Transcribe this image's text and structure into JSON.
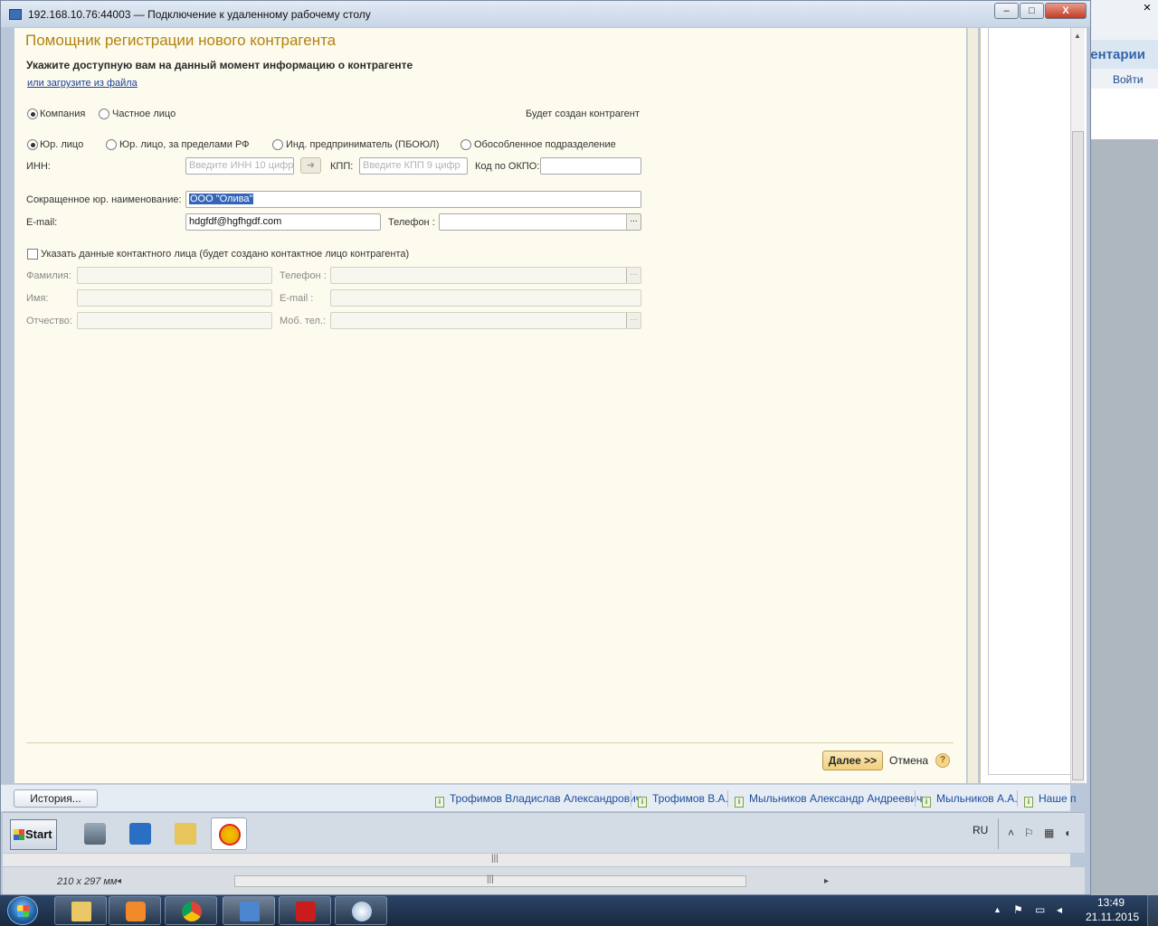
{
  "rdp_window": {
    "title": "192.168.10.76:44003 — Подключение к удаленному рабочему столу",
    "minimize": "–",
    "maximize": "□",
    "close": "X"
  },
  "background_app": {
    "header_fragment": "ентарии",
    "button": "Войти",
    "close": "×"
  },
  "form": {
    "title": "Помощник регистрации нового контрагента",
    "subtitle": "Укажите доступную вам на данный момент информацию о контрагенте",
    "load_link": "или загрузите из файла",
    "party_type": {
      "options": [
        "Компания",
        "Частное лицо"
      ],
      "selected": "Компания"
    },
    "will_create": "Будет создан контрагент",
    "legal_form": {
      "options": [
        "Юр. лицо",
        "Юр. лицо, за пределами РФ",
        "Инд. предприниматель (ПБОЮЛ)",
        "Обособленное подразделение"
      ],
      "selected": "Юр. лицо"
    },
    "inn": {
      "label": "ИНН:",
      "placeholder": "Введите ИНН 10 цифр",
      "value": ""
    },
    "kpp": {
      "label": "КПП:",
      "placeholder": "Введите КПП 9 цифр",
      "value": ""
    },
    "okpo": {
      "label": "Код по ОКПО:",
      "value": ""
    },
    "short_name": {
      "label": "Сокращенное юр. наименование:",
      "value": "ООО \"Олива\""
    },
    "email": {
      "label": "E-mail:",
      "value": "hdgfdf@hgfhgdf.com"
    },
    "phone": {
      "label": "Телефон :",
      "value": "",
      "picker": "..."
    },
    "contact_checkbox": {
      "label": "Указать данные контактного лица (будет создано контактное лицо контрагента)",
      "checked": false
    },
    "contact": {
      "surname_label": "Фамилия:",
      "name_label": "Имя:",
      "patronymic_label": "Отчество:",
      "phone_label": "Телефон  :",
      "email_label": "E-mail      :",
      "mobile_label": "Моб. тел.:",
      "picker": "..."
    },
    "next_button": "Далее >>",
    "cancel_link": "Отмена",
    "help": "?"
  },
  "history": {
    "button": "История...",
    "items": [
      "Трофимов Владислав Александрович",
      "Трофимов В.А.",
      "Мыльников Александр Андреевич",
      "Мыльников А.А.",
      "Наше п"
    ]
  },
  "remote_taskbar": {
    "start": "Start",
    "lang": "RU",
    "tray_up": "˄"
  },
  "remote_status": {
    "page_size": "210 x 297 мм",
    "left_arrow": "◂",
    "right_arrow": "▸",
    "grip": "|||"
  },
  "scroll_grip": "|||",
  "host_taskbar": {
    "time": "13:49",
    "date": "21.11.2015",
    "tray_up": "▲"
  },
  "colors": {
    "form_bg": "#fdfbee",
    "title_accent": "#b2820e",
    "link": "#1a3fa0",
    "selection": "#3465b8",
    "next_button": "#f2cf7c"
  }
}
